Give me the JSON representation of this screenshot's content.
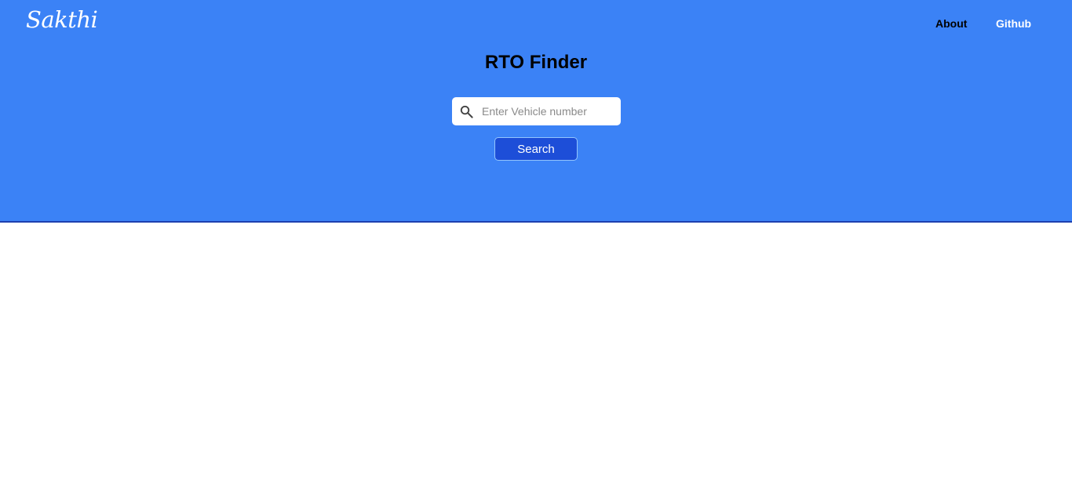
{
  "header": {
    "logo": "Sakthi",
    "nav": {
      "about": "About",
      "github": "Github"
    }
  },
  "main": {
    "title": "RTO Finder",
    "search": {
      "placeholder": "Enter Vehicle number",
      "value": "",
      "icon": "search-icon",
      "button_label": "Search"
    }
  },
  "colors": {
    "hero_background": "#3b82f6",
    "hero_border": "#1e40af",
    "button_background": "#1d4ed8",
    "page_background": "#ffffff"
  }
}
